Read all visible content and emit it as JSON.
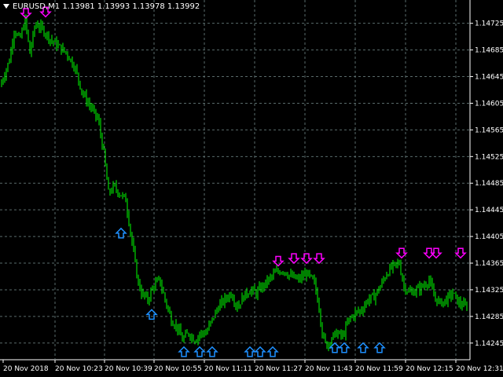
{
  "window": {
    "symbol": "EURUSD,M1",
    "ohlc": "1.13981 1.13993 1.13978 1.13992"
  },
  "colors": {
    "background": "#000000",
    "grid": "#5a6b6b",
    "candle": "#00ff00",
    "sell_arrow": "#ff00ff",
    "buy_arrow": "#1e90ff"
  },
  "price_axis": {
    "labels": [
      "1.14725",
      "1.14685",
      "1.14645",
      "1.14605",
      "1.14565",
      "1.14525",
      "1.14485",
      "1.14445",
      "1.14405",
      "1.14365",
      "1.14325",
      "1.14285",
      "1.14245"
    ],
    "current_price": "1.13992"
  },
  "time_axis": {
    "labels": [
      "20 Nov 2018",
      "20 Nov 10:23",
      "20 Nov 10:39",
      "20 Nov 10:55",
      "20 Nov 11:11",
      "20 Nov 11:27",
      "20 Nov 11:43",
      "20 Nov 11:59",
      "20 Nov 12:15",
      "20 Nov 12:31"
    ]
  },
  "chart_data": {
    "type": "candlestick",
    "symbol": "EURUSD",
    "timeframe": "M1",
    "y_range": [
      1.1422,
      1.1476
    ],
    "price_path": [
      [
        0,
        1.1463
      ],
      [
        6,
        1.1465
      ],
      [
        12,
        1.1467
      ],
      [
        18,
        1.14715
      ],
      [
        25,
        1.147
      ],
      [
        32,
        1.1473
      ],
      [
        38,
        1.1468
      ],
      [
        45,
        1.14725
      ],
      [
        55,
        1.14715
      ],
      [
        65,
        1.147
      ],
      [
        75,
        1.1469
      ],
      [
        85,
        1.1468
      ],
      [
        95,
        1.1466
      ],
      [
        105,
        1.1462
      ],
      [
        115,
        1.146
      ],
      [
        125,
        1.1458
      ],
      [
        132,
        1.1453
      ],
      [
        138,
        1.1447
      ],
      [
        145,
        1.1448
      ],
      [
        152,
        1.1447
      ],
      [
        160,
        1.1446
      ],
      [
        165,
        1.1442
      ],
      [
        170,
        1.1438
      ],
      [
        175,
        1.1434
      ],
      [
        180,
        1.1432
      ],
      [
        188,
        1.1431
      ],
      [
        195,
        1.1433
      ],
      [
        203,
        1.1434
      ],
      [
        210,
        1.1431
      ],
      [
        218,
        1.1428
      ],
      [
        225,
        1.1427
      ],
      [
        232,
        1.1425
      ],
      [
        240,
        1.1426
      ],
      [
        248,
        1.1425
      ],
      [
        255,
        1.1426
      ],
      [
        262,
        1.1426
      ],
      [
        270,
        1.1428
      ],
      [
        278,
        1.143
      ],
      [
        286,
        1.1431
      ],
      [
        294,
        1.1432
      ],
      [
        302,
        1.143
      ],
      [
        310,
        1.14315
      ],
      [
        318,
        1.14325
      ],
      [
        326,
        1.1432
      ],
      [
        334,
        1.1433
      ],
      [
        342,
        1.1434
      ],
      [
        350,
        1.1435
      ],
      [
        360,
        1.14355
      ],
      [
        370,
        1.14345
      ],
      [
        380,
        1.1434
      ],
      [
        390,
        1.1435
      ],
      [
        400,
        1.14335
      ],
      [
        406,
        1.143
      ],
      [
        410,
        1.1426
      ],
      [
        415,
        1.1424
      ],
      [
        420,
        1.1425
      ],
      [
        428,
        1.1426
      ],
      [
        436,
        1.14255
      ],
      [
        444,
        1.1428
      ],
      [
        452,
        1.1429
      ],
      [
        460,
        1.14295
      ],
      [
        468,
        1.1431
      ],
      [
        476,
        1.14315
      ],
      [
        484,
        1.1433
      ],
      [
        492,
        1.1435
      ],
      [
        500,
        1.1436
      ],
      [
        508,
        1.14365
      ],
      [
        514,
        1.1433
      ],
      [
        522,
        1.1432
      ],
      [
        530,
        1.14325
      ],
      [
        538,
        1.1433
      ],
      [
        546,
        1.1434
      ],
      [
        552,
        1.14315
      ],
      [
        560,
        1.14305
      ],
      [
        568,
        1.1431
      ],
      [
        576,
        1.1432
      ],
      [
        584,
        1.14305
      ],
      [
        592,
        1.143
      ],
      [
        598,
        1.14305
      ]
    ],
    "sell_signals": [
      {
        "x": 33,
        "price": 1.1474
      },
      {
        "x": 58,
        "price": 1.14742
      },
      {
        "x": 354,
        "price": 1.14368
      },
      {
        "x": 374,
        "price": 1.14372
      },
      {
        "x": 390,
        "price": 1.14372
      },
      {
        "x": 406,
        "price": 1.14372
      },
      {
        "x": 511,
        "price": 1.1438
      },
      {
        "x": 546,
        "price": 1.1438
      },
      {
        "x": 555,
        "price": 1.1438
      },
      {
        "x": 586,
        "price": 1.1438
      }
    ],
    "buy_signals": [
      {
        "x": 154,
        "price": 1.1441
      },
      {
        "x": 193,
        "price": 1.14288
      },
      {
        "x": 234,
        "price": 1.14232
      },
      {
        "x": 254,
        "price": 1.14232
      },
      {
        "x": 270,
        "price": 1.14232
      },
      {
        "x": 318,
        "price": 1.14232
      },
      {
        "x": 331,
        "price": 1.14232
      },
      {
        "x": 347,
        "price": 1.14232
      },
      {
        "x": 426,
        "price": 1.14238
      },
      {
        "x": 438,
        "price": 1.14238
      },
      {
        "x": 462,
        "price": 1.14238
      },
      {
        "x": 483,
        "price": 1.14238
      }
    ]
  }
}
